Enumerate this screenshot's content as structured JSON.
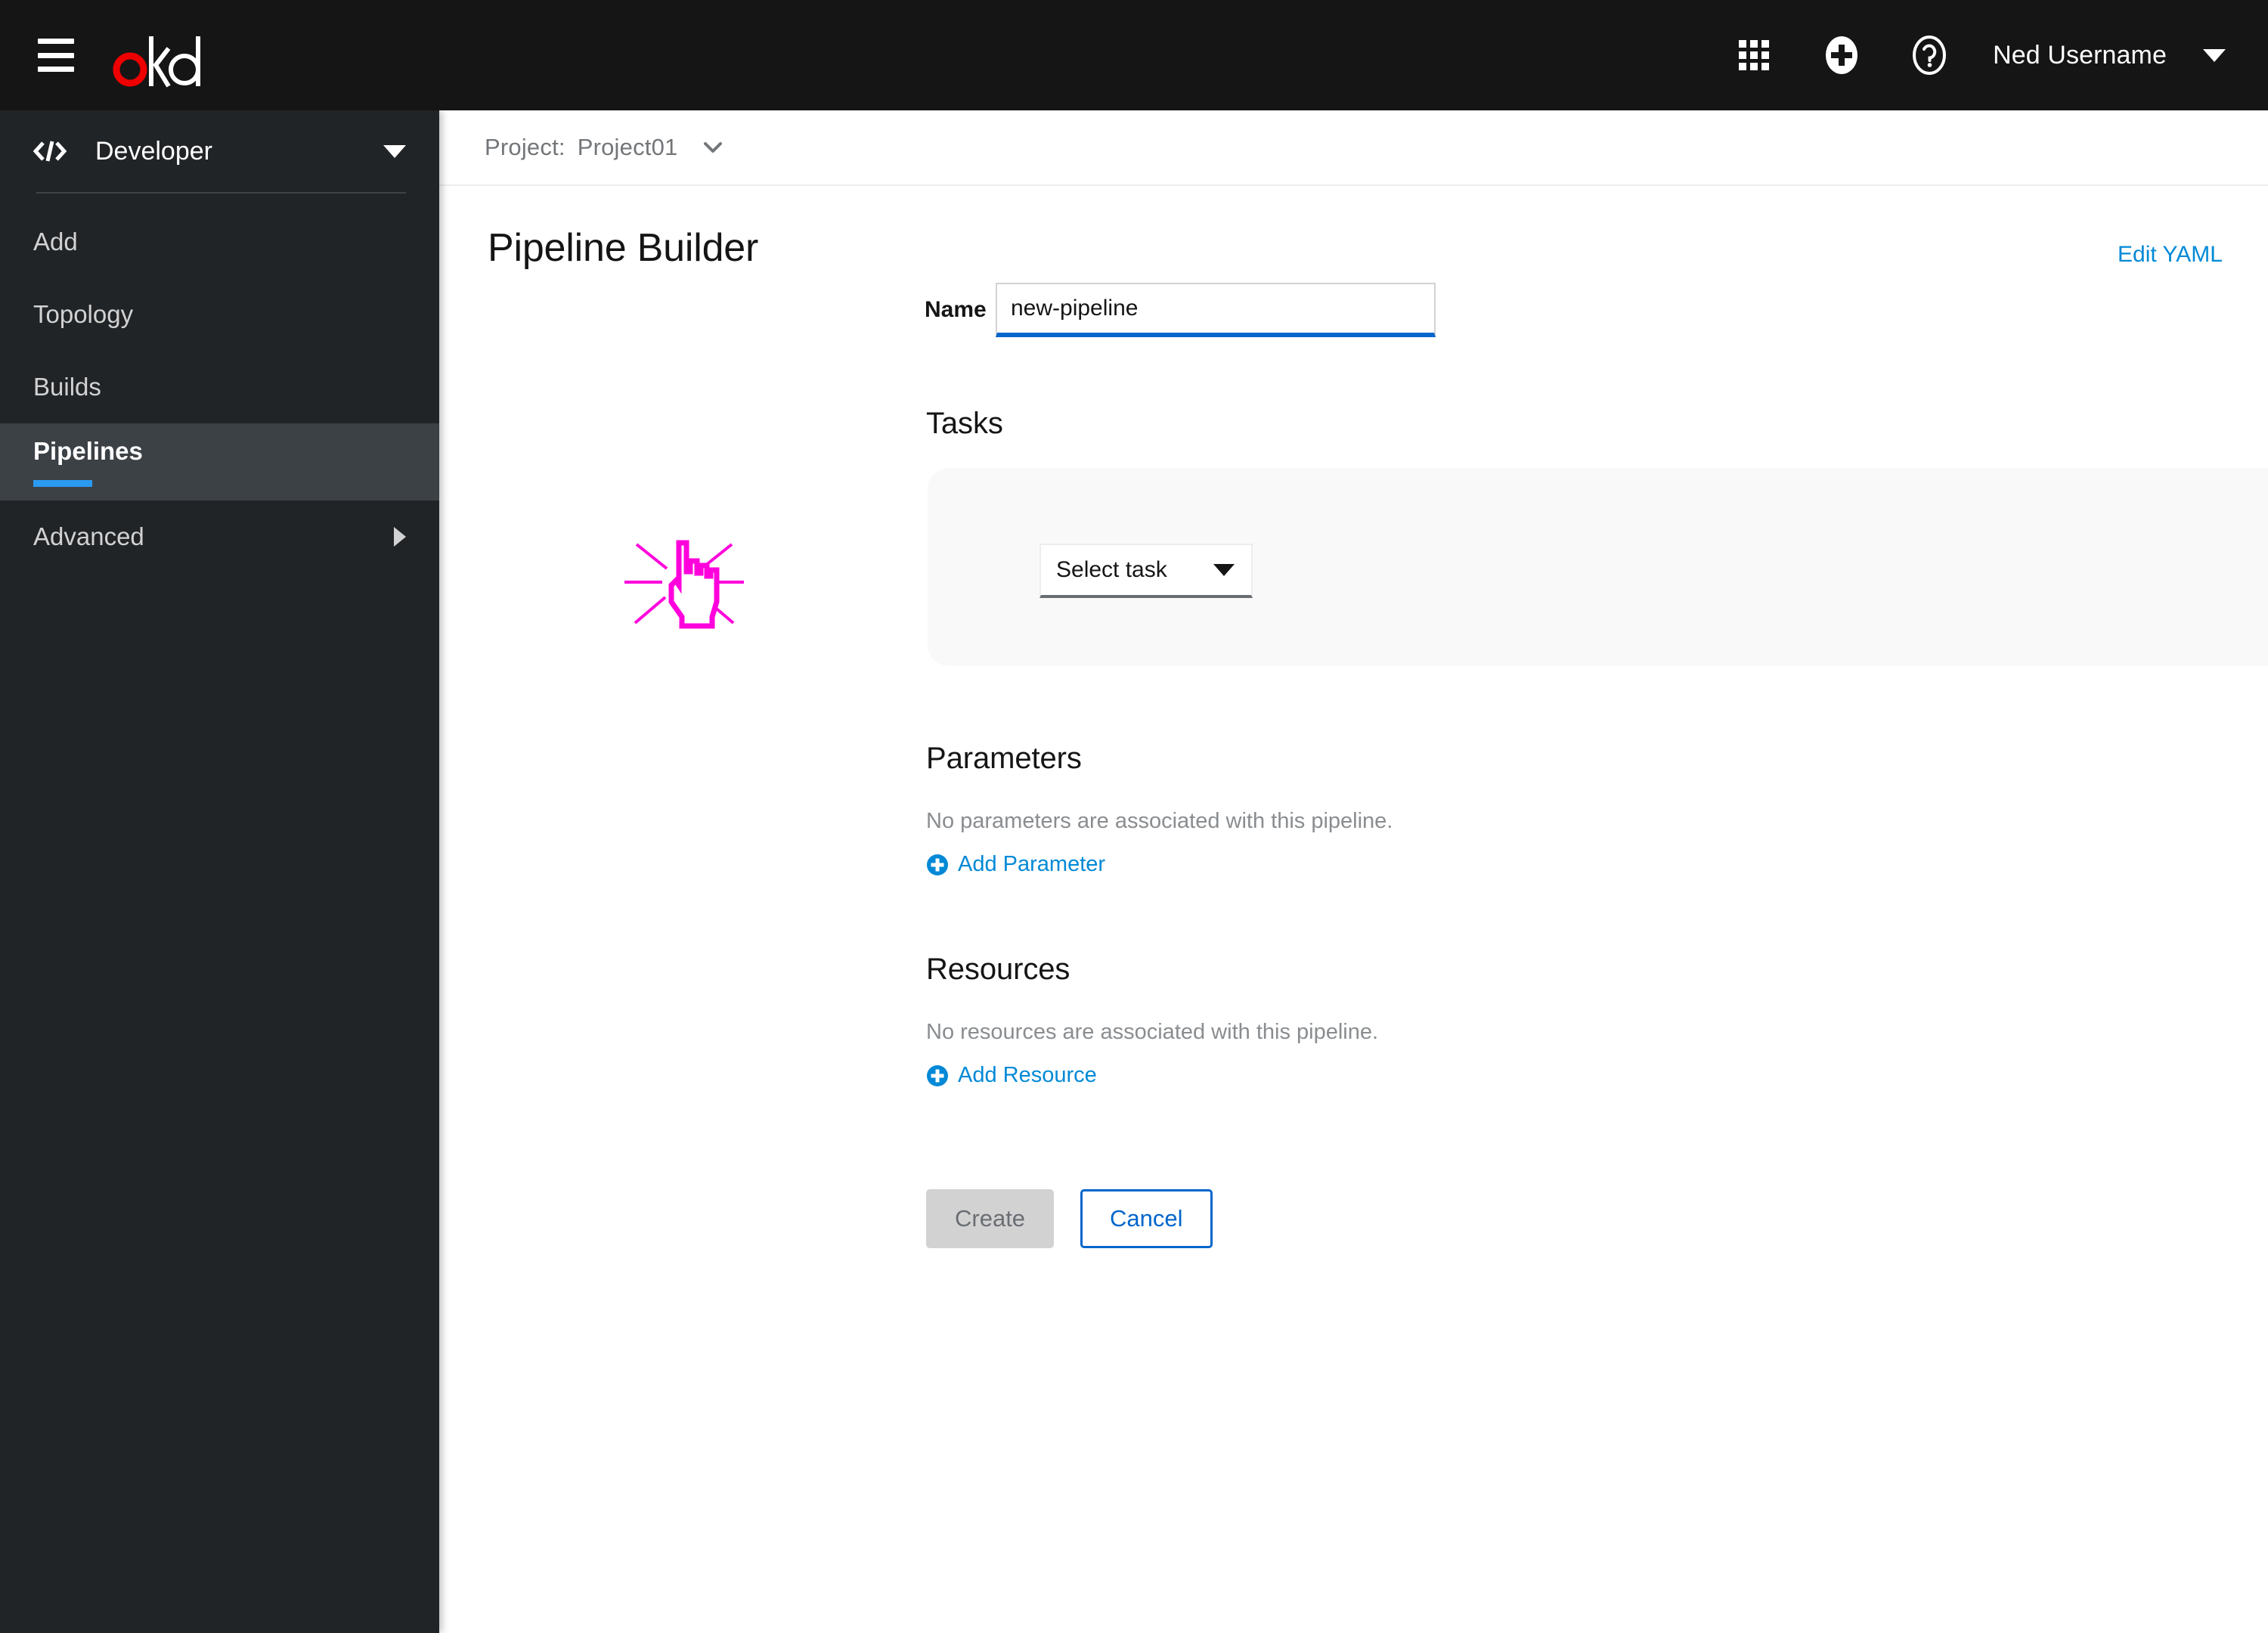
{
  "masthead": {
    "menu_icon": "hamburger-icon",
    "logo_text": "okd",
    "logo_accent_color": "#ee0000",
    "apps_icon": "grid-apps-icon",
    "add_icon": "plus-circle-icon",
    "help_icon": "question-circle-icon",
    "username": "Ned Username",
    "user_caret_icon": "caret-down-icon",
    "background_color": "#151515"
  },
  "sidebar": {
    "perspective": {
      "icon": "code-icon",
      "label": "Developer",
      "caret_icon": "caret-down-icon"
    },
    "items": [
      {
        "label": "Add",
        "active": false,
        "has_chevron": false
      },
      {
        "label": "Topology",
        "active": false,
        "has_chevron": false
      },
      {
        "label": "Builds",
        "active": false,
        "has_chevron": false
      },
      {
        "label": "Pipelines",
        "active": true,
        "has_chevron": false
      },
      {
        "label": "Advanced",
        "active": false,
        "has_chevron": true
      }
    ],
    "active_underline_color": "#2b9af3",
    "background_color": "#212427"
  },
  "project_bar": {
    "label": "Project:",
    "name": "Project01",
    "caret_icon": "chevron-down-icon"
  },
  "main": {
    "page_title": "Pipeline Builder",
    "edit_yaml_label": "Edit YAML",
    "name_field": {
      "label": "Name",
      "value": "new-pipeline",
      "placeholder": "Name"
    },
    "tasks": {
      "title": "Tasks",
      "select_task_label": "Select task",
      "select_caret_icon": "caret-down-icon"
    },
    "parameters": {
      "title": "Parameters",
      "empty_text": "No parameters are associated with this pipeline.",
      "add_label": "Add Parameter",
      "add_icon": "plus-circle-icon"
    },
    "resources": {
      "title": "Resources",
      "empty_text": "No resources are associated with this pipeline.",
      "add_label": "Add Resource",
      "add_icon": "plus-circle-icon"
    },
    "buttons": {
      "create_label": "Create",
      "cancel_label": "Cancel"
    },
    "link_color": "#0089d6",
    "primary_color": "#0066cc"
  },
  "cursor": {
    "icon": "pointing-hand-click-cursor",
    "color": "#ff00dd"
  }
}
